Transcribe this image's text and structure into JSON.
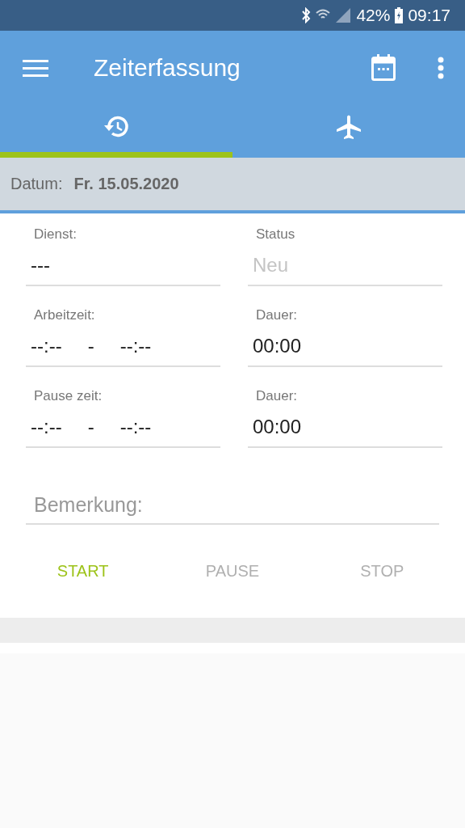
{
  "status_bar": {
    "battery": "42%",
    "time": "09:17"
  },
  "app_bar": {
    "title": "Zeiterfassung"
  },
  "tabs": [
    {
      "kind": "history",
      "selected": true
    },
    {
      "kind": "flight",
      "selected": false
    }
  ],
  "date_bar": {
    "label": "Datum:",
    "value": "Fr. 15.05.2020"
  },
  "fields": [
    {
      "kind": "text",
      "label": "Dienst:",
      "value": "---",
      "disabled": false
    },
    {
      "kind": "text",
      "label": "Status",
      "value": "Neu",
      "disabled": true
    },
    {
      "kind": "range",
      "label": "Arbeitzeit:",
      "from": "--:--",
      "separator": "-",
      "to": "--:--"
    },
    {
      "kind": "text",
      "label": "Dauer:",
      "value": "00:00",
      "disabled": false
    },
    {
      "kind": "range",
      "label": "Pause zeit:",
      "from": "--:--",
      "separator": "-",
      "to": "--:--"
    },
    {
      "kind": "text",
      "label": "Dauer:",
      "value": "00:00",
      "disabled": false
    }
  ],
  "remark": {
    "placeholder": "Bemerkung:"
  },
  "buttons": [
    {
      "label": "START",
      "disabled": false
    },
    {
      "label": "PAUSE",
      "disabled": true
    },
    {
      "label": "STOP",
      "disabled": true
    }
  ]
}
